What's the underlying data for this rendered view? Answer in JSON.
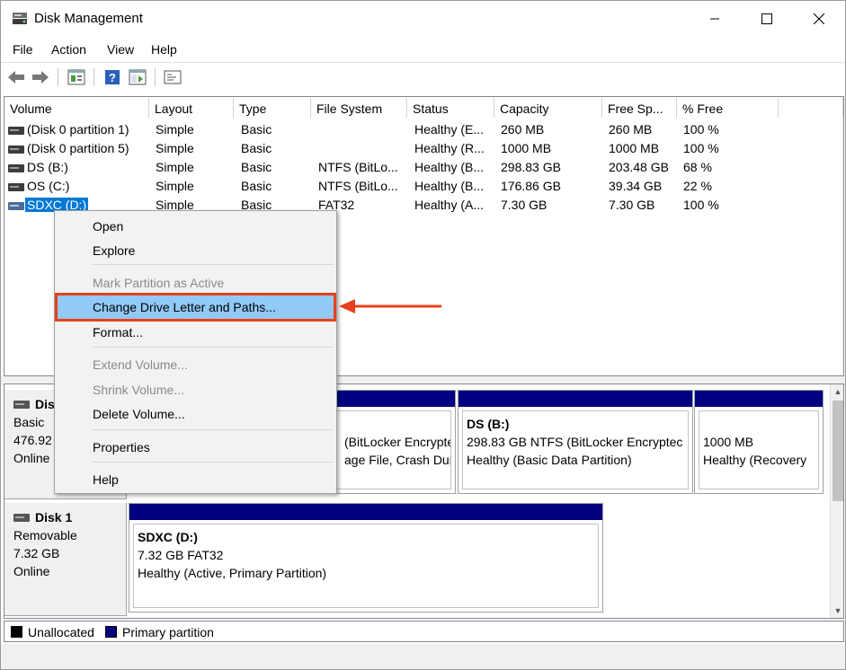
{
  "window": {
    "title": "Disk Management"
  },
  "menu": [
    "File",
    "Action",
    "View",
    "Help"
  ],
  "toolbar": {
    "icons": [
      "back-icon",
      "forward-icon",
      "properties-icon",
      "help-icon",
      "show-hide-icon",
      "console-icon"
    ]
  },
  "columns": [
    "Volume",
    "Layout",
    "Type",
    "File System",
    "Status",
    "Capacity",
    "Free Sp...",
    "% Free"
  ],
  "volumes": [
    {
      "volume": "(Disk 0 partition 1)",
      "layout": "Simple",
      "type": "Basic",
      "fs": "",
      "status": "Healthy (E...",
      "capacity": "260 MB",
      "free": "260 MB",
      "pct": "100 %"
    },
    {
      "volume": "(Disk 0 partition 5)",
      "layout": "Simple",
      "type": "Basic",
      "fs": "",
      "status": "Healthy (R...",
      "capacity": "1000 MB",
      "free": "1000 MB",
      "pct": "100 %"
    },
    {
      "volume": "DS (B:)",
      "layout": "Simple",
      "type": "Basic",
      "fs": "NTFS (BitLo...",
      "status": "Healthy (B...",
      "capacity": "298.83 GB",
      "free": "203.48 GB",
      "pct": "68 %"
    },
    {
      "volume": "OS (C:)",
      "layout": "Simple",
      "type": "Basic",
      "fs": "NTFS (BitLo...",
      "status": "Healthy (B...",
      "capacity": "176.86 GB",
      "free": "39.34 GB",
      "pct": "22 %"
    },
    {
      "volume": "SDXC (D:)",
      "layout": "Simple",
      "type": "Basic",
      "fs": "FAT32",
      "status": "Healthy (A...",
      "capacity": "7.30 GB",
      "free": "7.30 GB",
      "pct": "100 %"
    }
  ],
  "context_menu": {
    "open": "Open",
    "explore": "Explore",
    "mark_active": "Mark Partition as Active",
    "change_letter": "Change Drive Letter and Paths...",
    "format": "Format...",
    "extend": "Extend Volume...",
    "shrink": "Shrink Volume...",
    "delete": "Delete Volume...",
    "properties": "Properties",
    "help": "Help"
  },
  "disk0": {
    "name": "Dis",
    "type": "Basic",
    "size": "476.92",
    "state": "Online",
    "partition_c_line1": "(BitLocker Encrypte",
    "partition_c_line2": "age File, Crash Dur",
    "partition_ds": {
      "title": "DS  (B:)",
      "line1": "298.83 GB NTFS (BitLocker Encryptec",
      "line2": "Healthy (Basic Data Partition)"
    },
    "partition_rec": {
      "line1": "1000 MB",
      "line2": "Healthy (Recovery"
    }
  },
  "disk1": {
    "name": "Disk 1",
    "type": "Removable",
    "size": "7.32 GB",
    "state": "Online",
    "partition": {
      "title": "SDXC  (D:)",
      "line1": "7.32 GB FAT32",
      "line2": "Healthy (Active, Primary Partition)"
    }
  },
  "legend": {
    "unallocated": "Unallocated",
    "primary": "Primary partition"
  },
  "colors": {
    "primary_bar": "#000080",
    "selection": "#0078d7",
    "menu_highlight": "#91c9f7",
    "annotation": "#e8401c"
  }
}
